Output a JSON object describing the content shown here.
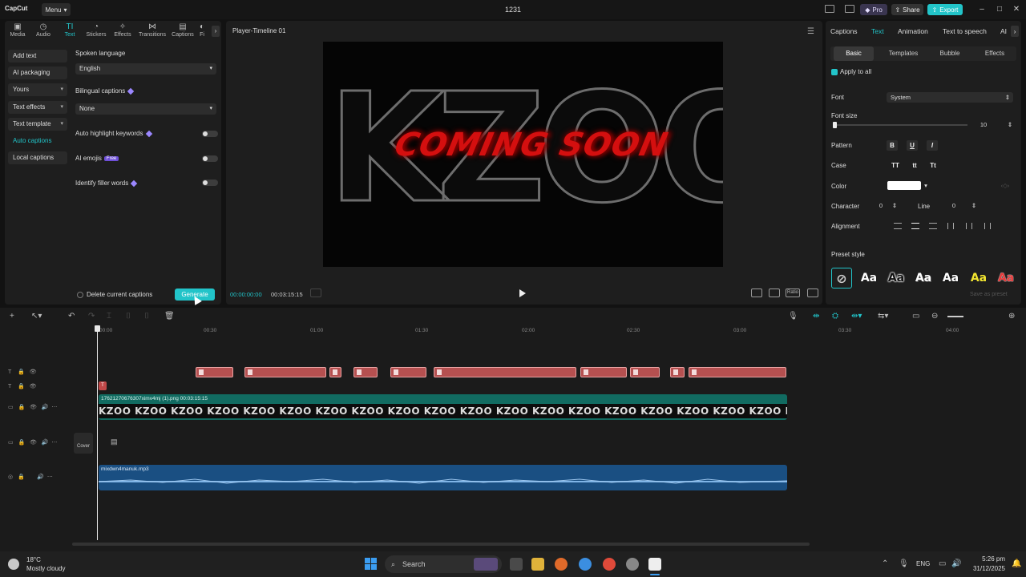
{
  "app": {
    "logo": "CapCut",
    "menu_label": "Menu",
    "project_title": "1231",
    "pro_label": "Pro",
    "share_label": "Share",
    "export_label": "Export"
  },
  "left_panel": {
    "tabs": [
      {
        "label": "Media",
        "icon": "media-icon"
      },
      {
        "label": "Audio",
        "icon": "audio-icon"
      },
      {
        "label": "Text",
        "icon": "text-icon",
        "active": true
      },
      {
        "label": "Stickers",
        "icon": "stickers-icon"
      },
      {
        "label": "Effects",
        "icon": "effects-icon"
      },
      {
        "label": "Transitions",
        "icon": "transitions-icon"
      },
      {
        "label": "Captions",
        "icon": "captions-icon"
      },
      {
        "label": "Fi",
        "icon": "filters-icon"
      }
    ],
    "nav": [
      {
        "label": "Add text"
      },
      {
        "label": "AI packaging"
      },
      {
        "label": "Yours"
      },
      {
        "label": "Text effects"
      },
      {
        "label": "Text template"
      },
      {
        "label": "Auto captions",
        "active": true
      },
      {
        "label": "Local captions"
      }
    ],
    "form": {
      "spoken_language_label": "Spoken language",
      "spoken_language_value": "English",
      "bilingual_label": "Bilingual captions",
      "bilingual_value": "None",
      "highlight_label": "Auto highlight keywords",
      "emojis_label": "AI emojis",
      "emojis_badge": "Free",
      "filler_label": "Identify filler words",
      "delete_label": "Delete current captions",
      "generate_label": "Generate"
    }
  },
  "player": {
    "title": "Player-Timeline 01",
    "video_big_text": "KZOO",
    "video_overlay_text": "COMING SOON",
    "time_current": "00:00:00:00",
    "time_total": "00:03:15:15",
    "ratio_label": "Ratio"
  },
  "right_panel": {
    "tabs": [
      "Captions",
      "Text",
      "Animation",
      "Text to speech",
      "AI"
    ],
    "active_tab": "Text",
    "sub_tabs": [
      "Basic",
      "Templates",
      "Bubble",
      "Effects"
    ],
    "active_sub_tab": "Basic",
    "apply_all_label": "Apply to all",
    "font_label": "Font",
    "font_value": "System",
    "font_size_label": "Font size",
    "font_size_value": "10",
    "pattern_label": "Pattern",
    "pattern_buttons": [
      "B",
      "U",
      "I"
    ],
    "case_label": "Case",
    "case_buttons": [
      "TT",
      "tt",
      "Tt"
    ],
    "color_label": "Color",
    "color_value": "#ffffff",
    "character_label": "Character",
    "character_value": "0",
    "line_label": "Line",
    "line_value": "0",
    "alignment_label": "Alignment",
    "preset_label": "Preset style",
    "presets": [
      "Aa",
      "Aa",
      "Aa",
      "Aa",
      "Aa",
      "Aa"
    ],
    "save_preset_label": "Save as preset"
  },
  "timeline": {
    "ticks": [
      "00:00",
      "00:30",
      "01:00",
      "01:30",
      "02:00",
      "02:30",
      "03:00",
      "03:30",
      "04:00"
    ],
    "video_clip_label": "17621270676307ximv4mj (1).png  00:03:15:15",
    "video_strip_text": "KZOO KZOO KZOO KZOO KZOO KZOO KZOO KZOO KZOO KZOO KZOO KZOO KZOO KZOO KZOO KZOO KZOO KZOO KZOO KZOO KZOO KZOO KZOO KZOO KZOO KZOO",
    "audio_clip_label": "mixdwn4manuk.mp3",
    "cover_label": "Cover"
  },
  "taskbar": {
    "weather_temp": "18°C",
    "weather_desc": "Mostly cloudy",
    "search_placeholder": "Search",
    "language": "ENG",
    "time": "5:26 pm",
    "date": "31/12/2025"
  },
  "colors": {
    "accent": "#22c4c9",
    "video_clip": "#116b61",
    "audio_clip": "#1a4f82",
    "caption_clip": "#b55050"
  }
}
